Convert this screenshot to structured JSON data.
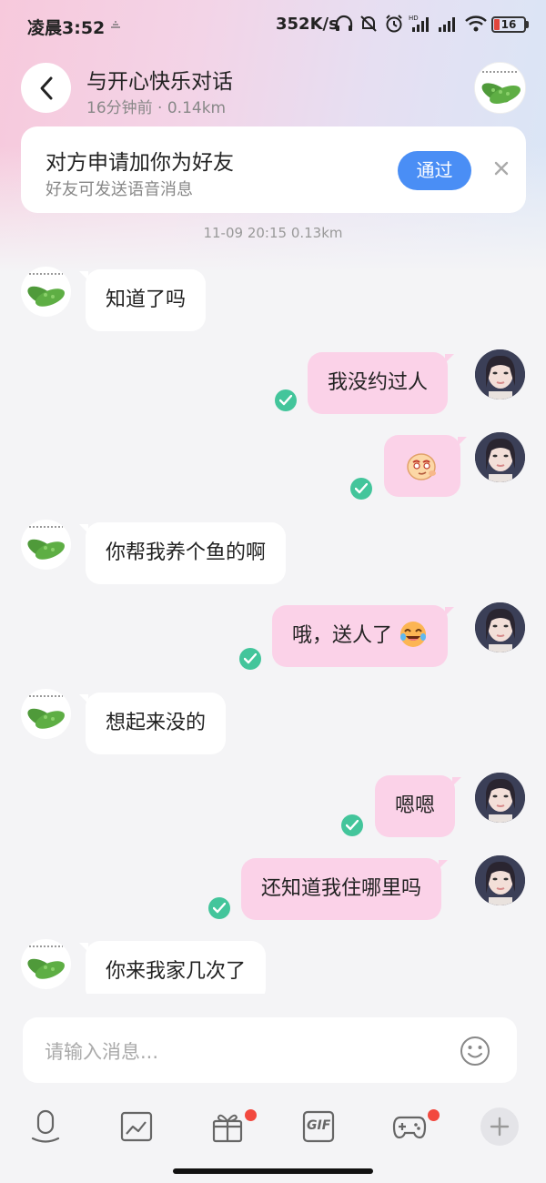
{
  "status_bar": {
    "time": "凌晨3:52",
    "network_speed": "352K/s",
    "battery_level": "16"
  },
  "header": {
    "title": "与开心快乐对话",
    "meta": "16分钟前 · 0.14km"
  },
  "friend_request": {
    "title": "对方申请加你为好友",
    "subtitle": "好友可发送语音消息",
    "approve_label": "通过"
  },
  "timestamp": "11-09 20:15  0.13km",
  "messages": [
    {
      "side": "in",
      "text": "知道了吗"
    },
    {
      "side": "out",
      "text": "我没约过人",
      "read": true
    },
    {
      "side": "out",
      "emoji": "thinking-face-sticker",
      "read": true
    },
    {
      "side": "in",
      "text": "你帮我养个鱼的啊"
    },
    {
      "side": "out",
      "text": "哦，送人了",
      "emoji": "laughing-crying-emoji",
      "read": true
    },
    {
      "side": "in",
      "text": "想起来没的"
    },
    {
      "side": "out",
      "text": "嗯嗯",
      "read": true
    },
    {
      "side": "out",
      "text": "还知道我住哪里吗",
      "read": true
    },
    {
      "side": "in",
      "text": "你来我家几次了"
    }
  ],
  "input": {
    "placeholder": "请输入消息..."
  },
  "toolbar": {
    "items": [
      "microphone-icon",
      "image-icon",
      "gift-icon",
      "gif-icon",
      "game-controller-icon",
      "plus-icon"
    ],
    "gif_label": "GIF"
  },
  "colors": {
    "accent_blue": "#4a8ef5",
    "outgoing_bubble": "#fbd2e8",
    "read_check": "#43c59b",
    "notification_dot": "#f2493f"
  }
}
